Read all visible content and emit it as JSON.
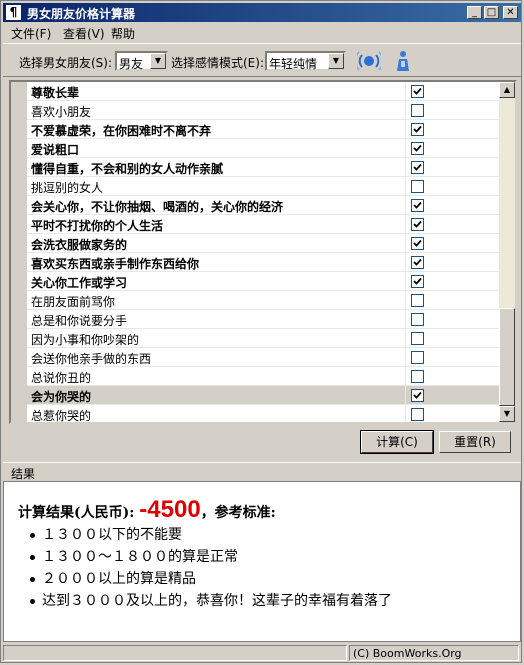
{
  "window": {
    "title": "男女朋友价格计算器",
    "controls": {
      "minimize": "_",
      "maximize": "□",
      "close": "✕"
    }
  },
  "menu": [
    {
      "label": "文件(F)"
    },
    {
      "label": "查看(V)"
    },
    {
      "label": "帮助"
    }
  ],
  "toolbar": {
    "type_label": "选择男女朋友(S):",
    "type_value": "男友",
    "mode_label": "选择感情模式(E):",
    "mode_value": "年轻纯情"
  },
  "items": [
    {
      "text": "尊敬长辈",
      "bold": true,
      "checked": true
    },
    {
      "text": "喜欢小朋友",
      "bold": false,
      "checked": false
    },
    {
      "text": "不爱慕虚荣，在你困难时不离不弃",
      "bold": true,
      "checked": true
    },
    {
      "text": "爱说粗口",
      "bold": true,
      "checked": true
    },
    {
      "text": "懂得自重，不会和别的女人动作亲腻",
      "bold": true,
      "checked": true
    },
    {
      "text": "挑逗别的女人",
      "bold": false,
      "checked": false
    },
    {
      "text": "会关心你，不让你抽烟、喝酒的，关心你的经济",
      "bold": true,
      "checked": true
    },
    {
      "text": "平时不打扰你的个人生活",
      "bold": true,
      "checked": true
    },
    {
      "text": "会洗衣服做家务的",
      "bold": true,
      "checked": true
    },
    {
      "text": "喜欢买东西或亲手制作东西给你",
      "bold": true,
      "checked": true
    },
    {
      "text": "关心你工作或学习",
      "bold": true,
      "checked": true
    },
    {
      "text": "在朋友面前骂你",
      "bold": false,
      "checked": false
    },
    {
      "text": "总是和你说要分手",
      "bold": false,
      "checked": false
    },
    {
      "text": "因为小事和你吵架的",
      "bold": false,
      "checked": false
    },
    {
      "text": "会送你他亲手做的东西",
      "bold": false,
      "checked": false
    },
    {
      "text": "总说你丑的",
      "bold": false,
      "checked": false
    },
    {
      "text": "会为你哭的",
      "bold": true,
      "checked": true,
      "selected": true
    },
    {
      "text": "总惹你哭的",
      "bold": false,
      "checked": false
    }
  ],
  "buttons": {
    "calc": "计算(C)",
    "reset": "重置(R)"
  },
  "result": {
    "header": "结果",
    "prefix": "计算结果(人民币):",
    "value": "-4500",
    "suffix": "，参考标准:",
    "standards": [
      "１３００以下的不能要",
      "１３００～１８００的算是正常",
      "２０００以上的算是精品",
      "达到３０００及以上的，恭喜你！这辈子的幸福有着落了"
    ]
  },
  "status": {
    "copyright": "(C) BoomWorks.Org"
  },
  "colors": {
    "title_start": "#0a246a",
    "title_end": "#3a6ea5",
    "result_value": "#e00000"
  },
  "icons": {
    "app": "app-icon",
    "tool1": "signal-icon",
    "tool2": "figure-icon"
  }
}
